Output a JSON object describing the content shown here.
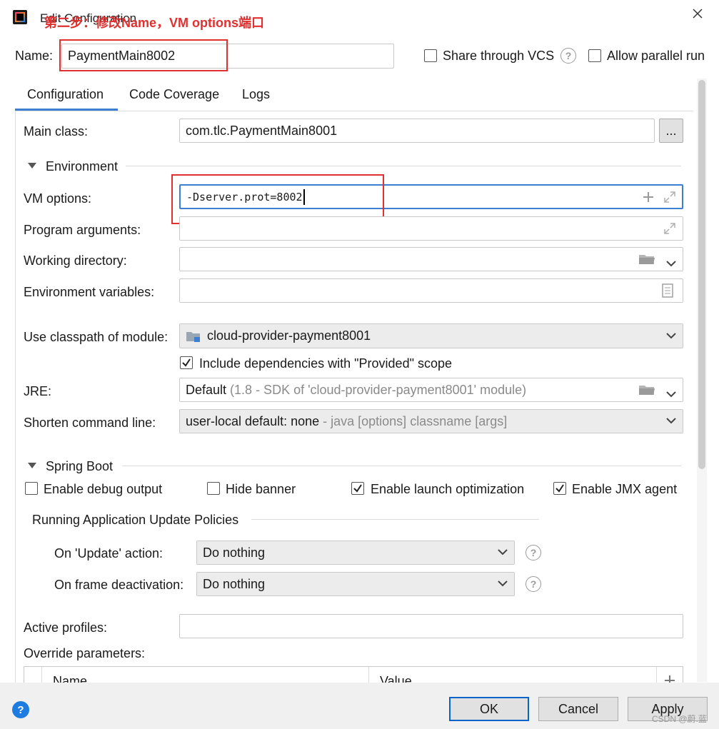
{
  "window": {
    "title": "Edit Configuration",
    "annotation": "第二步：修改Name，VM options端口"
  },
  "name_row": {
    "label": "Name:",
    "value": "PaymentMain8002",
    "share_vcs": "Share through VCS",
    "allow_parallel": "Allow parallel run"
  },
  "tabs": [
    {
      "label": "Configuration",
      "active": true
    },
    {
      "label": "Code Coverage",
      "active": false
    },
    {
      "label": "Logs",
      "active": false
    }
  ],
  "config": {
    "main_class_label": "Main class:",
    "main_class_value": "com.tlc.PaymentMain8001",
    "browse_label": "...",
    "environment_header": "Environment",
    "vm_options_label": "VM options:",
    "vm_options_value": "-Dserver.prot=8002",
    "program_args_label": "Program arguments:",
    "working_dir_label": "Working directory:",
    "env_vars_label": "Environment variables:",
    "classpath_label": "Use classpath of module:",
    "classpath_value": "cloud-provider-payment8001",
    "include_deps": "Include dependencies with \"Provided\" scope",
    "jre_label": "JRE:",
    "jre_value": "Default",
    "jre_hint": "(1.8 - SDK of 'cloud-provider-payment8001' module)",
    "shorten_label": "Shorten command line:",
    "shorten_value": "user-local default: none",
    "shorten_hint": "- java [options] classname [args]"
  },
  "spring_boot": {
    "header": "Spring Boot",
    "enable_debug": "Enable debug output",
    "hide_banner": "Hide banner",
    "enable_launch_opt": "Enable launch optimization",
    "enable_jmx": "Enable JMX agent",
    "update_policies_header": "Running Application Update Policies",
    "on_update_label": "On 'Update' action:",
    "on_update_value": "Do nothing",
    "on_frame_label": "On frame deactivation:",
    "on_frame_value": "Do nothing",
    "active_profiles_label": "Active profiles:",
    "override_params_label": "Override parameters:",
    "table_name_col": "Name",
    "table_value_col": "Value"
  },
  "footer": {
    "ok": "OK",
    "cancel": "Cancel",
    "apply": "Apply",
    "watermark": "CSDN @蔚.蓝"
  },
  "colors": {
    "accent": "#3c7fd1",
    "annotation": "#e03030"
  }
}
